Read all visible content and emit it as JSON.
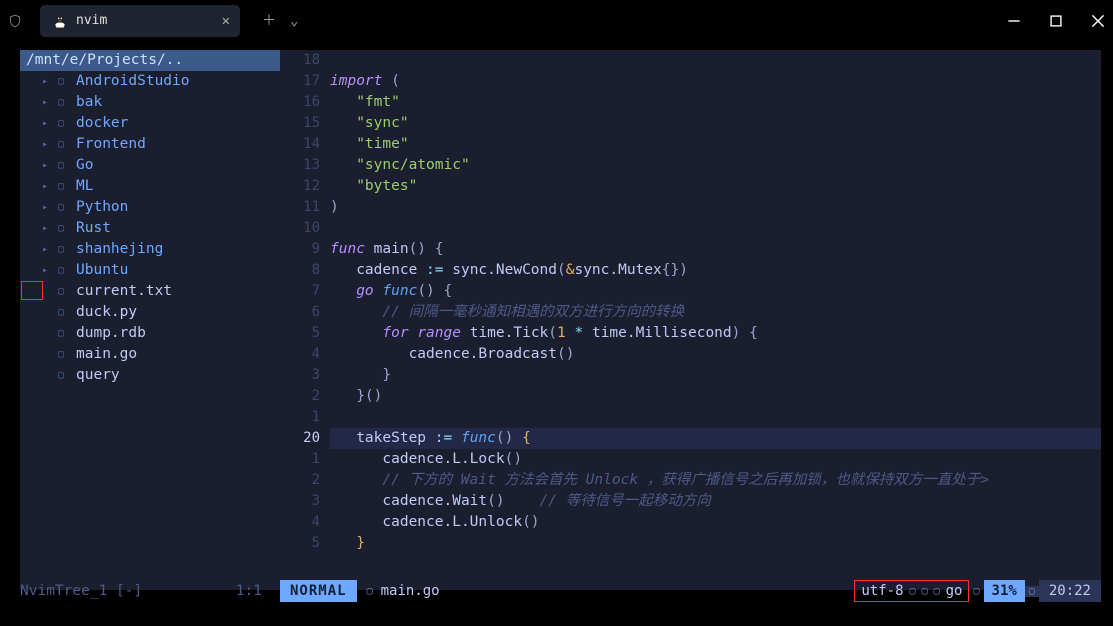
{
  "window": {
    "tab_title": "nvim"
  },
  "sidebar": {
    "breadcrumb": "/mnt/e/Projects/..",
    "items": [
      {
        "name": "AndroidStudio",
        "type": "dir"
      },
      {
        "name": "bak",
        "type": "dir"
      },
      {
        "name": "docker",
        "type": "dir"
      },
      {
        "name": "Frontend",
        "type": "dir"
      },
      {
        "name": "Go",
        "type": "dir"
      },
      {
        "name": "ML",
        "type": "dir"
      },
      {
        "name": "Python",
        "type": "dir"
      },
      {
        "name": "Rust",
        "type": "dir"
      },
      {
        "name": "shanhejing",
        "type": "dir"
      },
      {
        "name": "Ubuntu",
        "type": "dir"
      },
      {
        "name": "current.txt",
        "type": "file"
      },
      {
        "name": "duck.py",
        "type": "file"
      },
      {
        "name": "dump.rdb",
        "type": "file"
      },
      {
        "name": "main.go",
        "type": "file"
      },
      {
        "name": "query",
        "type": "file"
      }
    ]
  },
  "code": {
    "lines": [
      {
        "n": "18",
        "t": []
      },
      {
        "n": "17",
        "t": [
          [
            "kw",
            "import"
          ],
          [
            "pn",
            " ("
          ]
        ]
      },
      {
        "n": "16",
        "t": [
          [
            "pn",
            "   "
          ],
          [
            "str",
            "\"fmt\""
          ]
        ]
      },
      {
        "n": "15",
        "t": [
          [
            "pn",
            "   "
          ],
          [
            "str",
            "\"sync\""
          ]
        ]
      },
      {
        "n": "14",
        "t": [
          [
            "pn",
            "   "
          ],
          [
            "str",
            "\"time\""
          ]
        ]
      },
      {
        "n": "13",
        "t": [
          [
            "pn",
            "   "
          ],
          [
            "str",
            "\"sync/atomic\""
          ]
        ]
      },
      {
        "n": "12",
        "t": [
          [
            "pn",
            "   "
          ],
          [
            "str",
            "\"bytes\""
          ]
        ]
      },
      {
        "n": "11",
        "t": [
          [
            "pn",
            ")"
          ]
        ]
      },
      {
        "n": "10",
        "t": []
      },
      {
        "n": "9",
        "t": [
          [
            "kw",
            "func"
          ],
          [
            "id",
            " main"
          ],
          [
            "pn",
            "() {"
          ]
        ]
      },
      {
        "n": "8",
        "t": [
          [
            "id",
            "   cadence "
          ],
          [
            "op",
            ":="
          ],
          [
            "id",
            " sync.NewCond"
          ],
          [
            "pn",
            "("
          ],
          [
            "amp",
            "&"
          ],
          [
            "id",
            "sync.Mutex"
          ],
          [
            "pn",
            "{})"
          ]
        ]
      },
      {
        "n": "7",
        "t": [
          [
            "pn",
            "   "
          ],
          [
            "kw",
            "go"
          ],
          [
            "pn",
            " "
          ],
          [
            "fn",
            "func"
          ],
          [
            "pn",
            "() {"
          ]
        ]
      },
      {
        "n": "6",
        "t": [
          [
            "pn",
            "      "
          ],
          [
            "cm",
            "// 间隔一毫秒通知相遇的双方进行方向的转换"
          ]
        ]
      },
      {
        "n": "5",
        "t": [
          [
            "pn",
            "      "
          ],
          [
            "kw",
            "for"
          ],
          [
            "pn",
            " "
          ],
          [
            "kw",
            "range"
          ],
          [
            "id",
            " time.Tick"
          ],
          [
            "pn",
            "("
          ],
          [
            "num",
            "1"
          ],
          [
            "op",
            " * "
          ],
          [
            "id",
            "time.Millisecond"
          ],
          [
            "pn",
            ") {"
          ]
        ]
      },
      {
        "n": "4",
        "t": [
          [
            "id",
            "         cadence.Broadcast"
          ],
          [
            "pn",
            "()"
          ]
        ]
      },
      {
        "n": "3",
        "t": [
          [
            "pn",
            "      }"
          ]
        ]
      },
      {
        "n": "2",
        "t": [
          [
            "pn",
            "   }()"
          ]
        ]
      },
      {
        "n": "1",
        "t": []
      },
      {
        "n": "20",
        "current": true,
        "t": [
          [
            "id",
            "   takeStep "
          ],
          [
            "op",
            ":="
          ],
          [
            "pn",
            " "
          ],
          [
            "fn",
            "func"
          ],
          [
            "pn",
            "()"
          ],
          [
            "amp",
            " {"
          ]
        ]
      },
      {
        "n": "1",
        "t": [
          [
            "id",
            "      cadence.L.Lock"
          ],
          [
            "pn",
            "()"
          ]
        ]
      },
      {
        "n": "2",
        "t": [
          [
            "pn",
            "      "
          ],
          [
            "cm",
            "// 下方的 Wait 方法会首先 Unlock ，获得广播信号之后再加锁，也就保持双方一直处于>"
          ]
        ]
      },
      {
        "n": "3",
        "t": [
          [
            "id",
            "      cadence.Wait"
          ],
          [
            "pn",
            "()    "
          ],
          [
            "cm",
            "// 等待信号一起移动方向"
          ]
        ]
      },
      {
        "n": "4",
        "t": [
          [
            "id",
            "      cadence.L.Unlock"
          ],
          [
            "pn",
            "()"
          ]
        ]
      },
      {
        "n": "5",
        "t": [
          [
            "amp",
            "   }"
          ]
        ]
      }
    ]
  },
  "status": {
    "tree_name": "NvimTree_1",
    "tree_flags": "[-]",
    "tree_pos": "1:1",
    "mode": "NORMAL",
    "file": "main.go",
    "encoding": "utf-8",
    "lang": "go",
    "percent": "31%",
    "time": "20:22"
  }
}
